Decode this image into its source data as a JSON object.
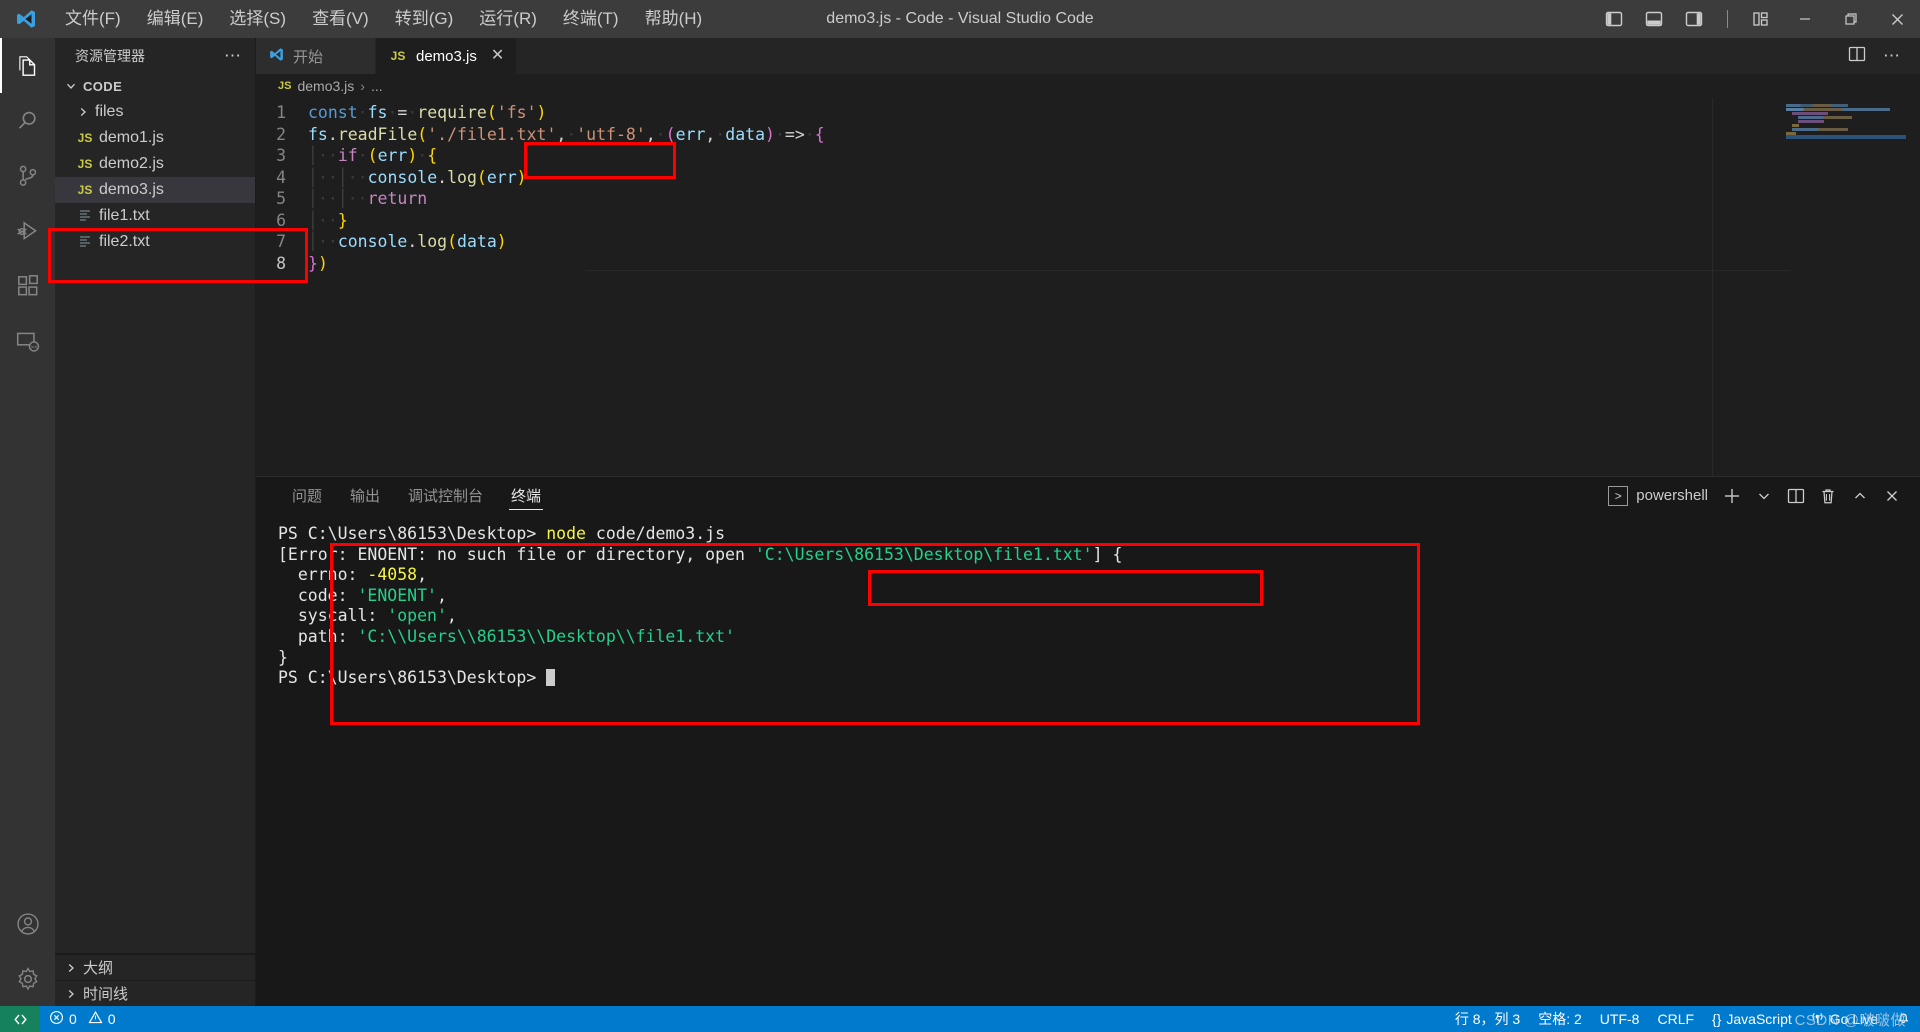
{
  "window": {
    "title": "demo3.js - Code - Visual Studio Code",
    "logo_icon": "vscode-logo-icon",
    "menus": [
      {
        "label": "文件(F)",
        "name": "menu-file"
      },
      {
        "label": "编辑(E)",
        "name": "menu-edit"
      },
      {
        "label": "选择(S)",
        "name": "menu-selection"
      },
      {
        "label": "查看(V)",
        "name": "menu-view"
      },
      {
        "label": "转到(G)",
        "name": "menu-go"
      },
      {
        "label": "运行(R)",
        "name": "menu-run"
      },
      {
        "label": "终端(T)",
        "name": "menu-terminal"
      },
      {
        "label": "帮助(H)",
        "name": "menu-help"
      }
    ],
    "layout_icons": [
      "toggle-primary-sidebar-icon",
      "toggle-panel-icon",
      "toggle-secondary-sidebar-icon",
      "customize-layout-icon"
    ],
    "controls": {
      "minimize": "minimize-icon",
      "maximize": "restore-icon",
      "close": "close-icon"
    }
  },
  "activitybar": {
    "items": [
      {
        "name": "activity-explorer",
        "icon": "files-icon",
        "active": true
      },
      {
        "name": "activity-search",
        "icon": "search-icon",
        "active": false
      },
      {
        "name": "activity-source-control",
        "icon": "source-control-icon",
        "active": false
      },
      {
        "name": "activity-run-debug",
        "icon": "run-and-debug-icon",
        "active": false
      },
      {
        "name": "activity-extensions",
        "icon": "extensions-icon",
        "active": false
      },
      {
        "name": "activity-remote",
        "icon": "remote-explorer-icon",
        "active": false
      }
    ],
    "bottom": [
      {
        "name": "activity-accounts",
        "icon": "account-icon"
      },
      {
        "name": "activity-settings",
        "icon": "gear-icon"
      }
    ]
  },
  "sidebar": {
    "title": "资源管理器",
    "more_icon": "ellipsis-icon",
    "root": {
      "label": "CODE",
      "chevron": "chevron-down-icon"
    },
    "tree": [
      {
        "label": "files",
        "type": "folder",
        "icon": "chevron-right-icon",
        "selected": false
      },
      {
        "label": "demo1.js",
        "type": "js",
        "icon": "js-file-icon",
        "selected": false
      },
      {
        "label": "demo2.js",
        "type": "js",
        "icon": "js-file-icon",
        "selected": false
      },
      {
        "label": "demo3.js",
        "type": "js",
        "icon": "js-file-icon",
        "selected": true
      },
      {
        "label": "file1.txt",
        "type": "txt",
        "icon": "text-file-icon",
        "selected": false
      },
      {
        "label": "file2.txt",
        "type": "txt",
        "icon": "text-file-icon",
        "selected": false
      }
    ],
    "sections": [
      {
        "label": "大纲",
        "chevron": "chevron-right-icon"
      },
      {
        "label": "时间线",
        "chevron": "chevron-right-icon"
      }
    ]
  },
  "editor": {
    "tabs": [
      {
        "label": "开始",
        "icon": "vscode-logo-icon",
        "active": false,
        "closable": false
      },
      {
        "label": "demo3.js",
        "icon": "js-file-icon",
        "active": true,
        "closable": true,
        "close_icon": "close-icon"
      }
    ],
    "tab_actions": [
      "split-editor-icon",
      "more-actions-icon"
    ],
    "breadcrumb": {
      "file": "demo3.js",
      "icon": "js-file-icon",
      "separator": "›",
      "tail": "..."
    },
    "lines": [
      {
        "n": "1",
        "text": "const fs = require('fs')"
      },
      {
        "n": "2",
        "text": "fs.readFile('./file1.txt', 'utf-8', (err, data) => {"
      },
      {
        "n": "3",
        "text": "    if (err) {"
      },
      {
        "n": "4",
        "text": "        console.log(err)"
      },
      {
        "n": "5",
        "text": "        return"
      },
      {
        "n": "6",
        "text": "    }"
      },
      {
        "n": "7",
        "text": "    console.log(data)"
      },
      {
        "n": "8",
        "text": "})"
      }
    ]
  },
  "panel": {
    "tabs": [
      {
        "label": "问题",
        "name": "panel-tab-problems",
        "active": false
      },
      {
        "label": "输出",
        "name": "panel-tab-output",
        "active": false
      },
      {
        "label": "调试控制台",
        "name": "panel-tab-debug-console",
        "active": false
      },
      {
        "label": "终端",
        "name": "panel-tab-terminal",
        "active": true
      }
    ],
    "shell_name": "powershell",
    "shell_icon": "terminal-icon",
    "actions": [
      {
        "name": "new-terminal-button",
        "icon": "plus-icon"
      },
      {
        "name": "terminal-profile-dropdown",
        "icon": "chevron-down-icon"
      },
      {
        "name": "split-terminal-button",
        "icon": "split-icon"
      },
      {
        "name": "kill-terminal-button",
        "icon": "trash-icon"
      },
      {
        "name": "maximize-panel-button",
        "icon": "chevron-up-icon"
      },
      {
        "name": "close-panel-button",
        "icon": "close-icon"
      }
    ],
    "terminal_lines": [
      {
        "segments": [
          {
            "t": "PS C:\\Users\\86153\\Desktop> ",
            "c": "white"
          },
          {
            "t": "node",
            "c": "yellow"
          },
          {
            "t": " code/demo3.js",
            "c": "white"
          }
        ]
      },
      {
        "segments": [
          {
            "t": "[Error: ENOENT: no such file or directory, open ",
            "c": "white"
          },
          {
            "t": "'C:\\Users\\86153\\Desktop\\file1.txt'",
            "c": "green"
          },
          {
            "t": "] {",
            "c": "white"
          }
        ]
      },
      {
        "segments": [
          {
            "t": "  errno: ",
            "c": "white"
          },
          {
            "t": "-4058",
            "c": "yellow"
          },
          {
            "t": ",",
            "c": "white"
          }
        ]
      },
      {
        "segments": [
          {
            "t": "  code: ",
            "c": "white"
          },
          {
            "t": "'ENOENT'",
            "c": "green"
          },
          {
            "t": ",",
            "c": "white"
          }
        ]
      },
      {
        "segments": [
          {
            "t": "  syscall: ",
            "c": "white"
          },
          {
            "t": "'open'",
            "c": "green"
          },
          {
            "t": ",",
            "c": "white"
          }
        ]
      },
      {
        "segments": [
          {
            "t": "  path: ",
            "c": "white"
          },
          {
            "t": "'C:\\\\Users\\\\86153\\\\Desktop\\\\file1.txt'",
            "c": "green"
          }
        ]
      },
      {
        "segments": [
          {
            "t": "}",
            "c": "white"
          }
        ]
      },
      {
        "segments": [
          {
            "t": "PS C:\\Users\\86153\\Desktop> ",
            "c": "white"
          }
        ]
      }
    ]
  },
  "statusbar": {
    "remote_icon": "remote-window-icon",
    "errors": {
      "icon": "error-icon",
      "count": "0"
    },
    "warnings": {
      "icon": "warning-icon",
      "count": "0"
    },
    "cursor_position": "行 8，列 3",
    "indentation": "空格: 2",
    "encoding": "UTF-8",
    "eol": "CRLF",
    "language": "JavaScript",
    "language_icon": "{}",
    "go_live": "Go Live",
    "go_live_icon": "broadcast-icon",
    "bell_icon": "bell-icon"
  },
  "annotations": [
    {
      "name": "annotation-explorer-files",
      "note": "red box around demo3.js and file1.txt in explorer"
    },
    {
      "name": "annotation-code-filepath",
      "note": "red box around './file1.txt',"
    },
    {
      "name": "annotation-terminal-block",
      "note": "red box around the error output block"
    },
    {
      "name": "annotation-terminal-path",
      "note": "red box around resolved absolute path"
    }
  ],
  "watermark": "CSDN @啵啵做"
}
